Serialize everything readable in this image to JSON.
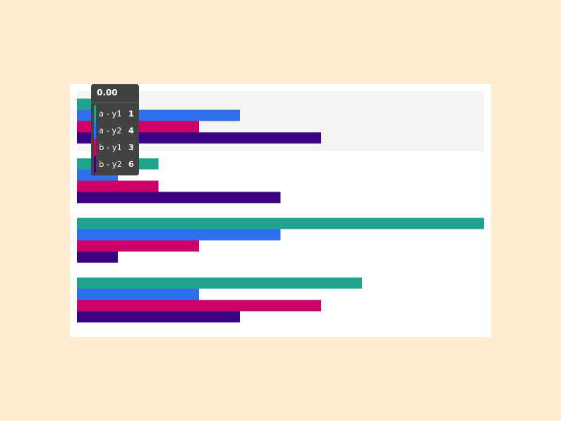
{
  "chart_data": {
    "type": "bar",
    "orientation": "horizontal",
    "categories": [
      "",
      "",
      "",
      ""
    ],
    "series": [
      {
        "name": "a - y1",
        "color": "#1fa58f",
        "values": [
          1,
          2,
          10,
          7
        ]
      },
      {
        "name": "a - y2",
        "color": "#2f6fed",
        "values": [
          4,
          1,
          5,
          3
        ]
      },
      {
        "name": "b - y1",
        "color": "#cc0066",
        "values": [
          3,
          2,
          3,
          6
        ]
      },
      {
        "name": "b - y2",
        "color": "#3c0082",
        "values": [
          6,
          5,
          1,
          4
        ]
      }
    ],
    "xlim": [
      0,
      10
    ],
    "grid": false,
    "hover_band_color": "#f4f4f4",
    "hovered_category_index": 0
  },
  "tooltip": {
    "title": "0.00",
    "rows": [
      {
        "label": "a - y1",
        "value": "1",
        "color": "#1fa58f"
      },
      {
        "label": "a - y2",
        "value": "4",
        "color": "#2f6fed"
      },
      {
        "label": "b - y1",
        "value": "3",
        "color": "#cc0066"
      },
      {
        "label": "b - y2",
        "value": "6",
        "color": "#3c0082"
      }
    ]
  }
}
